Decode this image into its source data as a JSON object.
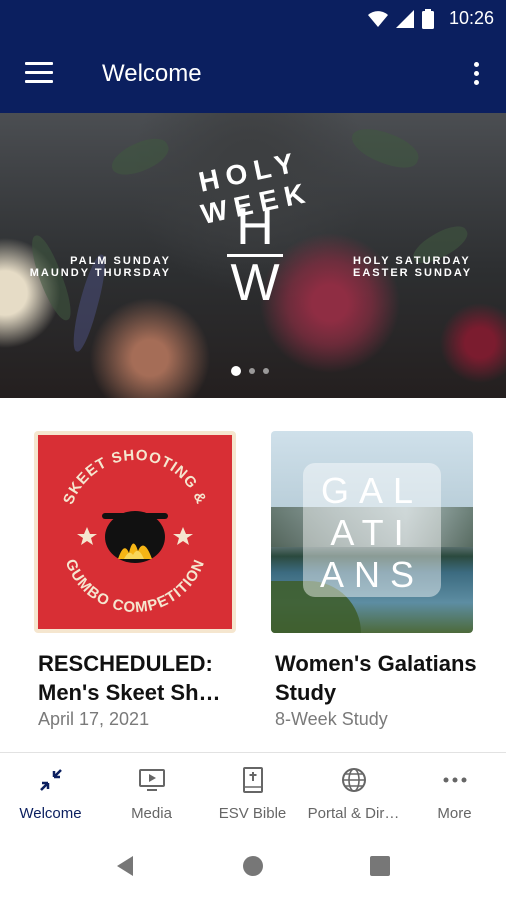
{
  "status": {
    "time": "10:26"
  },
  "appbar": {
    "title": "Welcome"
  },
  "hero": {
    "heading": "HOLY WEEK",
    "monogram_top": "H",
    "monogram_bottom": "W",
    "left_lines": [
      "PALM SUNDAY",
      "MAUNDY THURSDAY"
    ],
    "right_lines": [
      "HOLY SATURDAY",
      "EASTER SUNDAY"
    ]
  },
  "cards": [
    {
      "title": "RESCHEDULED: Men's Skeet Sh…",
      "subtitle": "April 17, 2021",
      "art_top": "SKEET SHOOTING &",
      "art_bottom": "GUMBO COMPETITION",
      "colors": {
        "bg": "#d82f35",
        "frame": "#f5e6cf"
      }
    },
    {
      "title": "Women's Galatians Study",
      "subtitle": "8-Week Study",
      "art_lines": [
        "GAL",
        "ATI",
        "ANS"
      ]
    }
  ],
  "bottom_nav": [
    {
      "label": "Welcome",
      "icon": "collapse-arrows-icon",
      "active": true
    },
    {
      "label": "Media",
      "icon": "play-screen-icon",
      "active": false
    },
    {
      "label": "ESV Bible",
      "icon": "bible-icon",
      "active": false
    },
    {
      "label": "Portal & Dir…",
      "icon": "globe-icon",
      "active": false
    },
    {
      "label": "More",
      "icon": "more-dots-icon",
      "active": false
    }
  ],
  "colors": {
    "primary": "#0b1f5f",
    "active_nav": "#0b1f5f",
    "inactive_nav": "#666666"
  }
}
